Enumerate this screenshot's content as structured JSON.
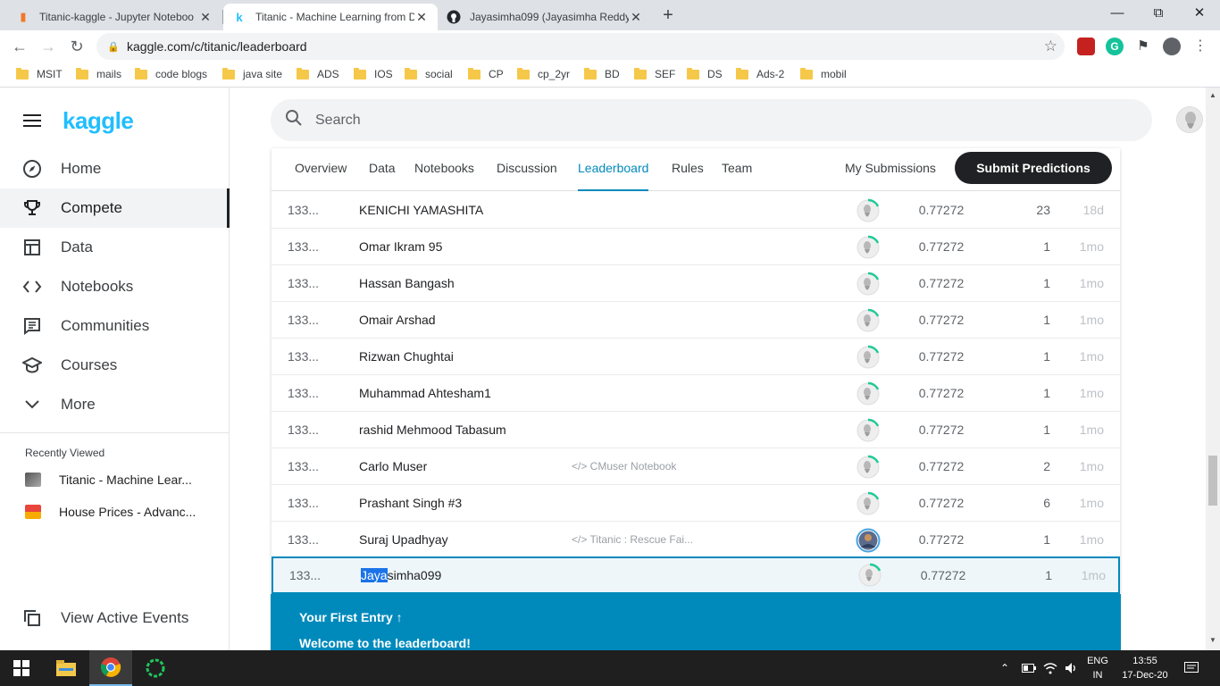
{
  "browser": {
    "tabs": [
      {
        "title": "Titanic-kaggle - Jupyter Noteboo",
        "icon": "jupyter-icon",
        "active": false
      },
      {
        "title": "Titanic - Machine Learning from D",
        "icon": "kaggle-k-icon",
        "active": true
      },
      {
        "title": "Jayasimha099 (Jayasimha Reddy)",
        "icon": "github-icon",
        "active": false
      }
    ],
    "url": "kaggle.com/c/titanic/leaderboard",
    "bookmarks": [
      "MSIT",
      "mails",
      "code blogs",
      "java site",
      "ADS",
      "IOS",
      "social",
      "CP",
      "cp_2yr",
      "BD",
      "SEF",
      "DS",
      "Ads-2",
      "mobil"
    ]
  },
  "sidebar": {
    "logo": "kaggle",
    "items": [
      {
        "label": "Home",
        "icon": "compass-icon"
      },
      {
        "label": "Compete",
        "icon": "trophy-icon"
      },
      {
        "label": "Data",
        "icon": "table-icon"
      },
      {
        "label": "Notebooks",
        "icon": "code-icon"
      },
      {
        "label": "Communities",
        "icon": "comment-icon"
      },
      {
        "label": "Courses",
        "icon": "school-icon"
      },
      {
        "label": "More",
        "icon": "chevron-down-icon"
      }
    ],
    "recent_title": "Recently Viewed",
    "recent": [
      {
        "label": "Titanic - Machine Lear..."
      },
      {
        "label": "House Prices - Advanc..."
      }
    ],
    "footer": "View Active Events"
  },
  "search": {
    "placeholder": "Search"
  },
  "competition_tabs": [
    "Overview",
    "Data",
    "Notebooks",
    "Discussion",
    "Leaderboard",
    "Rules",
    "Team"
  ],
  "active_tab": "Leaderboard",
  "my_submissions": "My Submissions",
  "submit_button": "Submit Predictions",
  "leaderboard": [
    {
      "rank": "133...",
      "team": "KENICHI YAMASHITA",
      "notebook": "",
      "score": "0.77272",
      "entries": "23",
      "last": "18d"
    },
    {
      "rank": "133...",
      "team": "Omar Ikram 95",
      "notebook": "",
      "score": "0.77272",
      "entries": "1",
      "last": "1mo"
    },
    {
      "rank": "133...",
      "team": "Hassan Bangash",
      "notebook": "",
      "score": "0.77272",
      "entries": "1",
      "last": "1mo"
    },
    {
      "rank": "133...",
      "team": "Omair Arshad",
      "notebook": "",
      "score": "0.77272",
      "entries": "1",
      "last": "1mo"
    },
    {
      "rank": "133...",
      "team": "Rizwan Chughtai",
      "notebook": "",
      "score": "0.77272",
      "entries": "1",
      "last": "1mo"
    },
    {
      "rank": "133...",
      "team": "Muhammad Ahtesham1",
      "notebook": "",
      "score": "0.77272",
      "entries": "1",
      "last": "1mo"
    },
    {
      "rank": "133...",
      "team": "rashid Mehmood Tabasum",
      "notebook": "",
      "score": "0.77272",
      "entries": "1",
      "last": "1mo"
    },
    {
      "rank": "133...",
      "team": "Carlo Muser",
      "notebook": "</> CMuser Notebook",
      "score": "0.77272",
      "entries": "2",
      "last": "1mo"
    },
    {
      "rank": "133...",
      "team": "Prashant Singh #3",
      "notebook": "",
      "score": "0.77272",
      "entries": "6",
      "last": "1mo"
    },
    {
      "rank": "133...",
      "team": "Suraj Upadhyay",
      "notebook": "</> Titanic : Rescue Fai...",
      "score": "0.77272",
      "entries": "1",
      "last": "1mo"
    }
  ],
  "my_entry": {
    "rank": "133...",
    "team_highlight": "Jaya",
    "team_rest": "simha099",
    "score": "0.77272",
    "entries": "1",
    "last": "1mo"
  },
  "banner": {
    "title": "Your First Entry ↑",
    "message": "Welcome to the leaderboard!"
  },
  "taskbar": {
    "lang_top": "ENG",
    "lang_bottom": "IN",
    "time": "13:55",
    "date": "17-Dec-20"
  },
  "colors": {
    "kaggle_blue": "#20beff",
    "accent": "#008abc",
    "dark_button": "#202124"
  }
}
